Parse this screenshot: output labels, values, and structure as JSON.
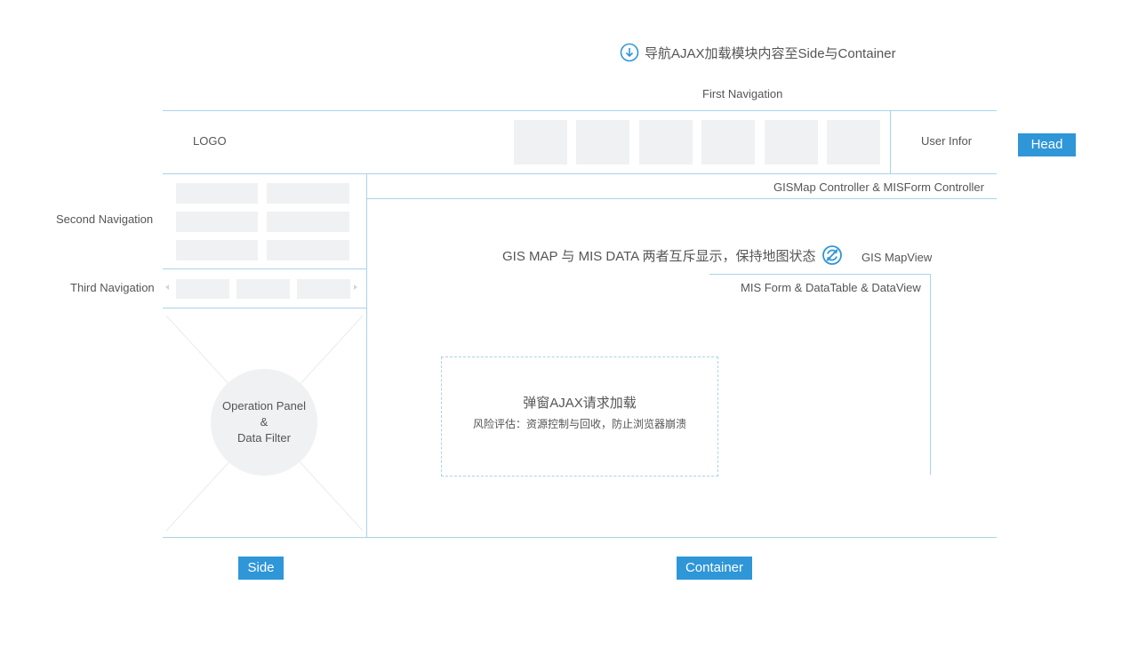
{
  "notes": {
    "top_note": "导航AJAX加载模块内容至Side与Container",
    "gis_mis_note": "GIS MAP 与 MIS DATA 两者互斥显示，保持地图状态"
  },
  "head": {
    "first_navigation": "First Navigation",
    "logo": "LOGO",
    "user_info": "User Infor",
    "nav_item_count": 6
  },
  "side": {
    "second_navigation": "Second Navigation",
    "third_navigation": "Third Navigation",
    "operation_panel_line1": "Operation Panel",
    "operation_panel_line2": "&",
    "operation_panel_line3": "Data Filter"
  },
  "container": {
    "controller_label": "GISMap Controller & MISForm Controller",
    "gis_mapview": "GIS MapView",
    "mis_form_label": "MIS Form & DataTable & DataView",
    "popup_title": "弹窗AJAX请求加载",
    "popup_subtitle": "风险评估：资源控制与回收，防止浏览器崩溃"
  },
  "tags": {
    "head": "Head",
    "side": "Side",
    "container": "Container"
  },
  "colors": {
    "line": "#a9d3ea",
    "accent": "#2f96d8",
    "placeholder": "#eff1f2",
    "text": "#555555"
  }
}
